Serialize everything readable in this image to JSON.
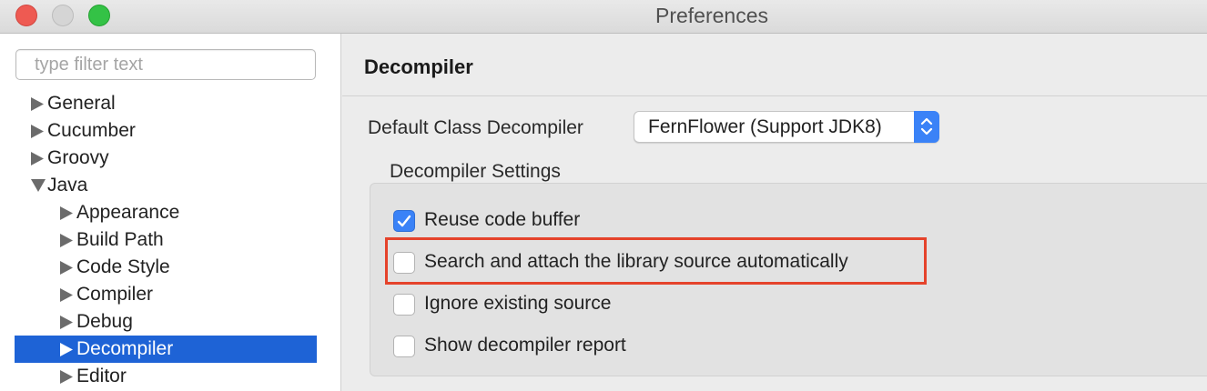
{
  "window": {
    "title": "Preferences"
  },
  "sidebar": {
    "filter_placeholder": "type filter text",
    "items": [
      {
        "label": "General",
        "expanded": false,
        "selected": false
      },
      {
        "label": "Cucumber",
        "expanded": false,
        "selected": false
      },
      {
        "label": "Groovy",
        "expanded": false,
        "selected": false
      },
      {
        "label": "Java",
        "expanded": true,
        "selected": false
      },
      {
        "label": "Appearance",
        "expanded": false,
        "selected": false
      },
      {
        "label": "Build Path",
        "expanded": false,
        "selected": false
      },
      {
        "label": "Code Style",
        "expanded": false,
        "selected": false
      },
      {
        "label": "Compiler",
        "expanded": false,
        "selected": false
      },
      {
        "label": "Debug",
        "expanded": false,
        "selected": false
      },
      {
        "label": "Decompiler",
        "expanded": false,
        "selected": true
      },
      {
        "label": "Editor",
        "expanded": false,
        "selected": false
      }
    ]
  },
  "main": {
    "title": "Decompiler",
    "default_decompiler_label": "Default Class Decompiler",
    "default_decompiler_value": "FernFlower (Support JDK8)",
    "settings_group_label": "Decompiler Settings",
    "options": [
      {
        "label": "Reuse code buffer",
        "checked": true
      },
      {
        "label": "Search and attach the library source automatically",
        "checked": false,
        "highlighted": true
      },
      {
        "label": "Ignore existing source",
        "checked": false
      },
      {
        "label": "Show decompiler report",
        "checked": false
      }
    ]
  },
  "colors": {
    "selection": "#1e63d6",
    "accent": "#3a82f7",
    "highlight_border": "#e5432b"
  }
}
